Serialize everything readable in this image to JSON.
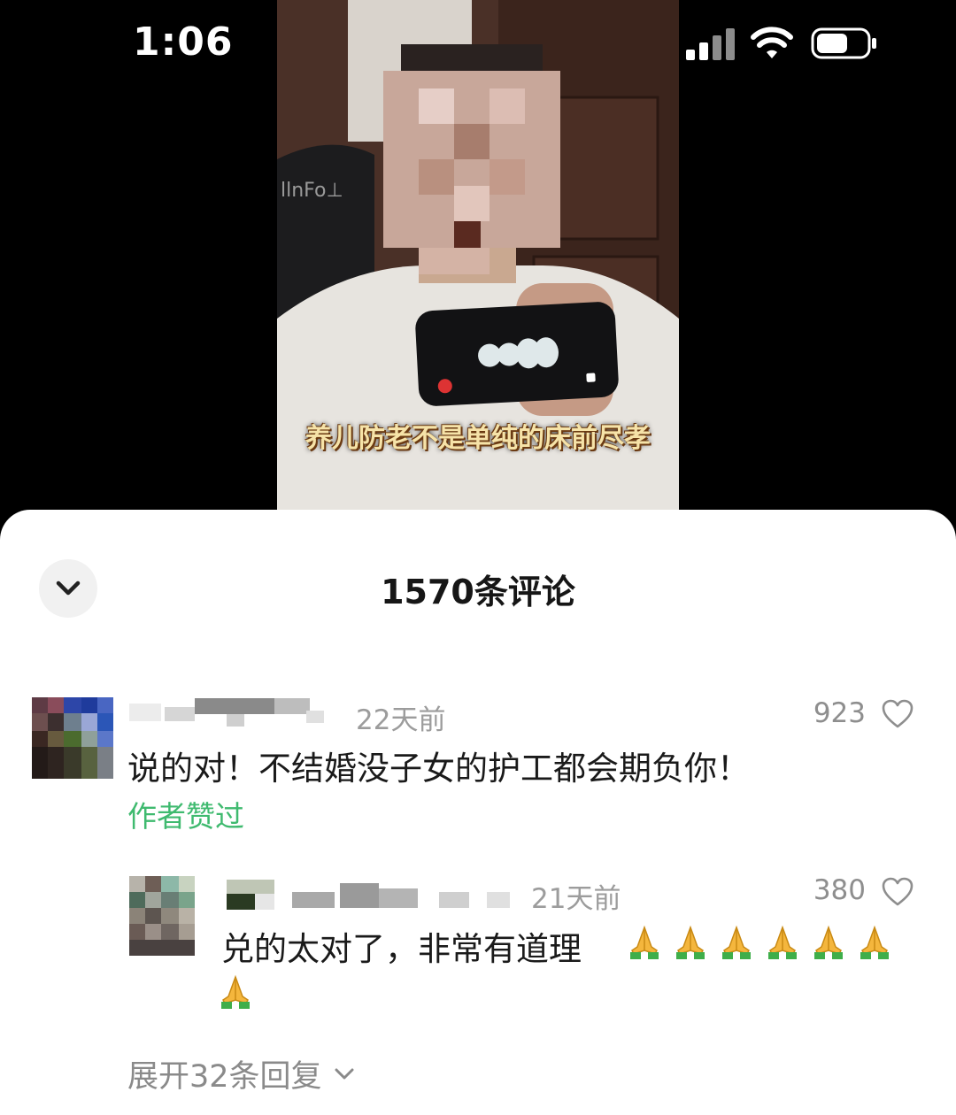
{
  "status_bar": {
    "time": "1:06"
  },
  "video": {
    "caption": "养儿防老不是单纯的床前尽孝"
  },
  "comments_panel": {
    "title": "1570条评论",
    "comments": [
      {
        "time": "22天前",
        "likes": "923",
        "text": "说的对！不结婚没子女的护工都会期负你！",
        "badge": "作者赞过"
      }
    ],
    "reply": {
      "time": "21天前",
      "likes": "380",
      "text": "兑的太对了，非常有道理"
    },
    "expand_label": "展开32条回复"
  },
  "colors": {
    "accent_green": "#3fba6f",
    "muted_gray": "#9c9c9c"
  },
  "icons": [
    "signal-icon",
    "wifi-icon",
    "battery-icon",
    "chevron-down-icon",
    "heart-icon",
    "folded-hands-emoji"
  ]
}
